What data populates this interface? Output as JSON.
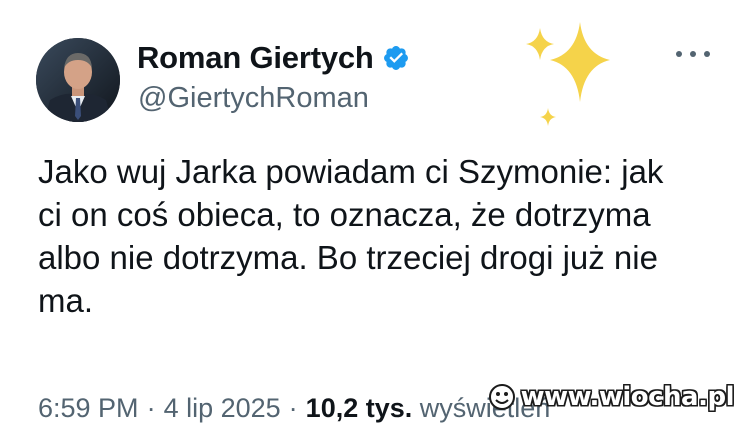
{
  "author": {
    "display_name": "Roman Giertych",
    "handle": "@GiertychRoman",
    "verified": true,
    "verified_color": "#1d9bf0"
  },
  "tweet": {
    "text_lines": [
      "Jako wuj Jarka powiadam ci Szymonie: jak",
      "ci on coś obieca, to oznacza, że dotrzyma",
      "albo nie dotrzyma. Bo trzeciej drogi już nie",
      "ma."
    ]
  },
  "meta": {
    "time": "6:59 PM",
    "separator": "·",
    "date": "4 lip 2025",
    "views_count": "10,2 tys.",
    "views_label": "wyświetleń"
  },
  "decorations": {
    "sparkles_icon": "sparkles-icon",
    "sparkle_color": "#f5d34a"
  },
  "watermark": {
    "text": "www.wiocha.pl"
  }
}
